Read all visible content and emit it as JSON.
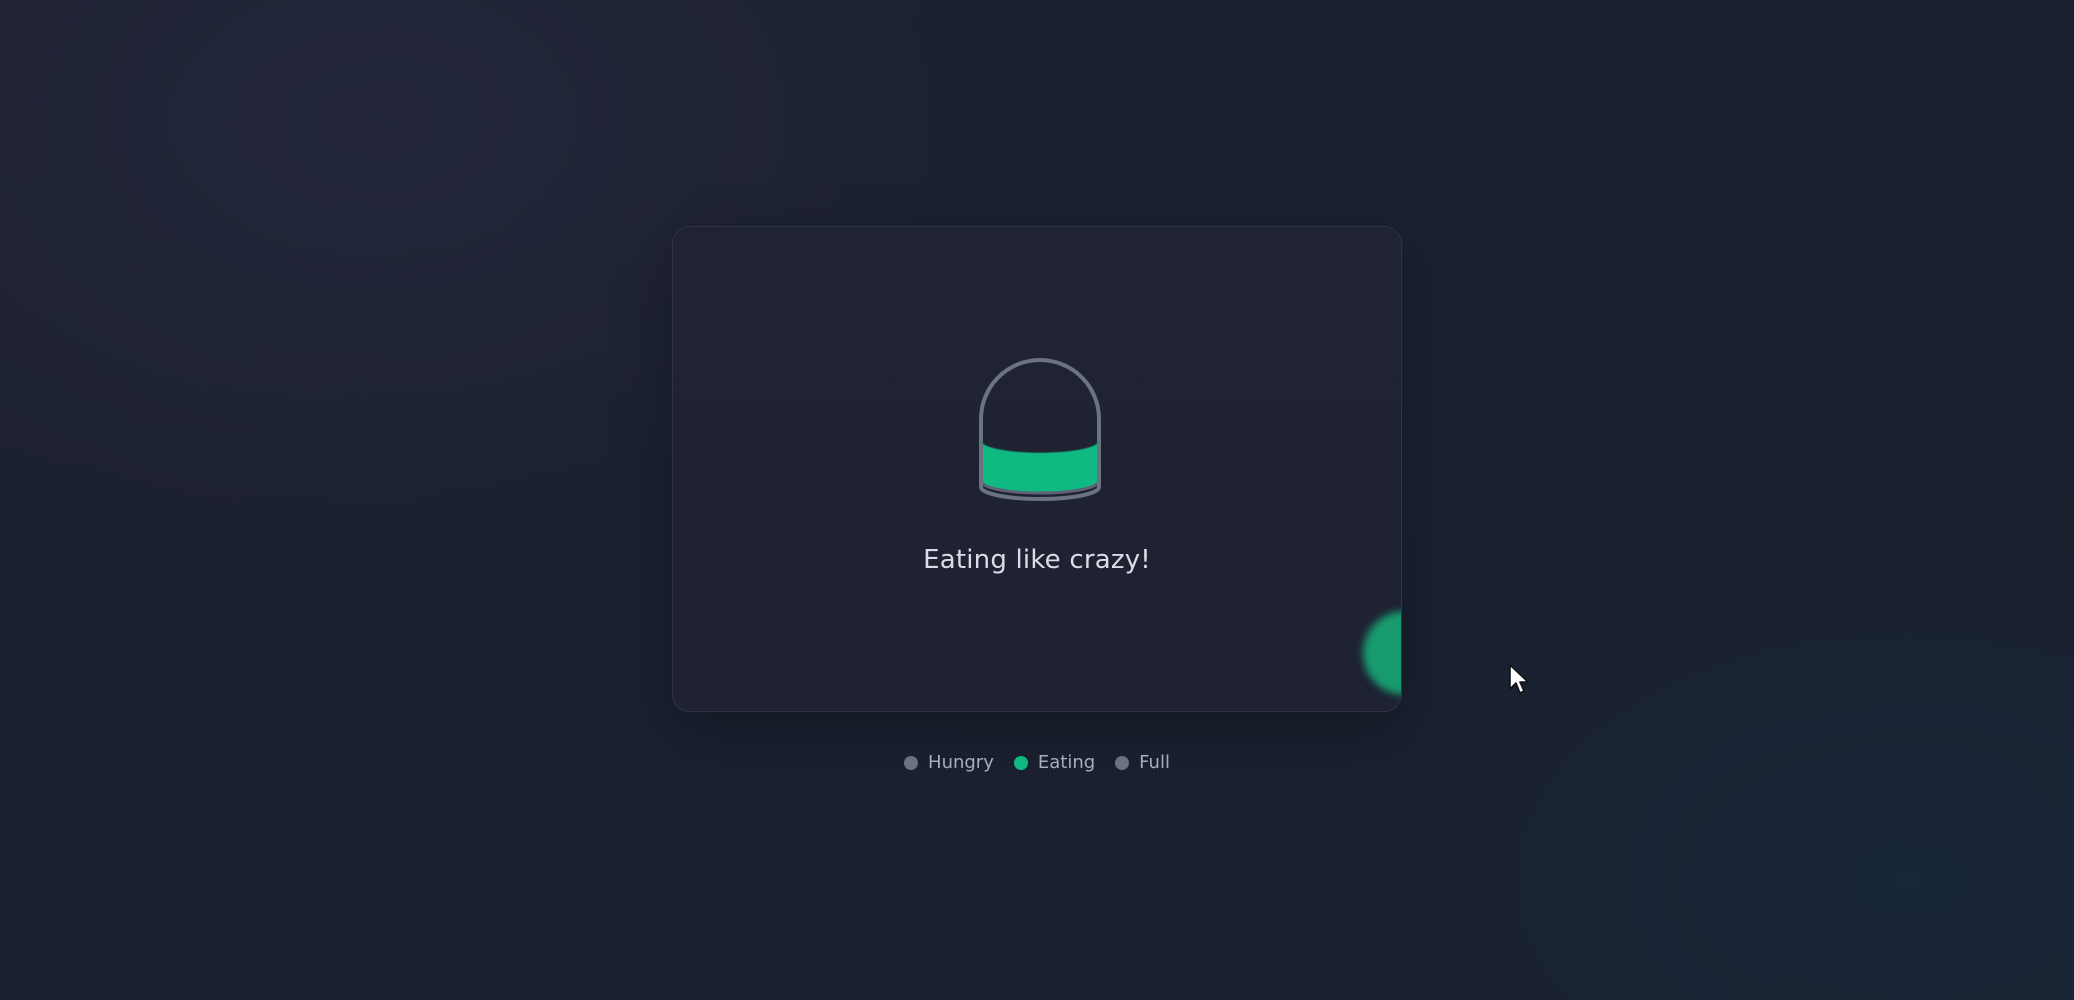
{
  "status": {
    "message": "Eating like crazy!",
    "fill_level": 0.42
  },
  "legend": {
    "items": [
      {
        "label": "Hungry",
        "active": false
      },
      {
        "label": "Eating",
        "active": true
      },
      {
        "label": "Full",
        "active": false
      }
    ]
  },
  "colors": {
    "accent": "#10b981",
    "inactive_dot": "#6b7180",
    "background": "#1b2030",
    "card": "#1f2334"
  },
  "icons": {
    "jar": "food-jar-icon",
    "cursor": "mouse-pointer-icon"
  }
}
